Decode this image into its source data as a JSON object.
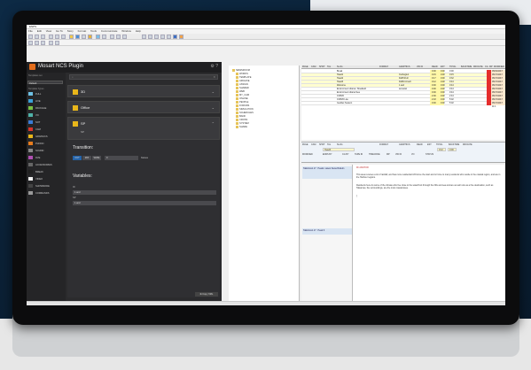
{
  "window": {
    "title": "ENPS"
  },
  "menu": [
    "File",
    "Edit",
    "View",
    "Go To",
    "Story",
    "Format",
    "Tools",
    "Communicate",
    "Window",
    "Help"
  ],
  "plugin": {
    "title": "Mosart NCS Plugin",
    "templates_label": "Templates set",
    "templates_value": "Default",
    "types_label": "Template Types",
    "side_items": [
      {
        "label": "FULL",
        "color": "#6ec1e4"
      },
      {
        "label": "LIVE",
        "color": "#3aa0d8"
      },
      {
        "label": "PACKAGE",
        "color": "#7ac143"
      },
      {
        "label": "VO",
        "color": "#4fb3a9"
      },
      {
        "label": "SOT",
        "color": "#3a7bd5"
      },
      {
        "label": "CAM",
        "color": "#d9342b"
      },
      {
        "label": "GRAPHICS",
        "color": "#e8b61a"
      },
      {
        "label": "PHONO",
        "color": "#e77c1d"
      },
      {
        "label": "SOUND",
        "color": "#888888"
      },
      {
        "label": "DVE",
        "color": "#b04fb2"
      },
      {
        "label": "ACCESSORIES",
        "color": "#666666"
      },
      {
        "label": "BREAK",
        "color": "#202020"
      },
      {
        "label": "VIDEO",
        "color": "#f0f0f0"
      },
      {
        "label": "SHOWMODE",
        "color": "#444444"
      },
      {
        "label": "COMMANDS",
        "color": "#999999"
      }
    ],
    "sections": [
      {
        "label": "3D"
      },
      {
        "label": "Office"
      },
      {
        "label": "SP"
      }
    ],
    "sp_sub": "SP",
    "transition_label": "Transition:",
    "transition_buttons": [
      "CUT",
      "MIX",
      "WIPE"
    ],
    "transition_value": "0",
    "transition_unit": "frames",
    "variables_label": "Variables:",
    "var1_label": "ID",
    "var1_value": "1 and",
    "var2_label": "SP",
    "var2_value": "1 and",
    "copy_button": "Copy XML"
  },
  "tree": [
    "NEWSROOM",
    "WORKS",
    "TEMPLATE",
    "ARCHIVE",
    "ASSIGN",
    "SHARED",
    "WEB",
    "MY_CAM",
    "ONLINE",
    "PEOPLE",
    "FORUMS",
    "SIMULATION",
    "SCHEDULES",
    "BANK",
    "CROSS",
    "SYSTEM",
    "SHARE"
  ],
  "grid": {
    "headers": [
      "PAGE",
      "CAM",
      "SHOT",
      "TAL",
      "SLUG",
      "FORMAT",
      "GRAPHICS",
      "VID ID",
      "READ",
      "EST",
      "TOTAL",
      "BACKTIME",
      "MR DATE",
      "CG",
      "MP",
      "MODIFIED"
    ],
    "rows": [
      {
        "slug": "Break",
        "grx": "",
        "read": "0:00",
        "est": "0:00",
        "tot": "0:00",
        "mod": "05/04/2017 15:0"
      },
      {
        "slug": "Head1",
        "grx": "CutAngle1",
        "read": "0:15",
        "est": "0:00",
        "tot": "0:15",
        "mod": "05/17/2017 11:1"
      },
      {
        "slug": "Head2",
        "grx": "DollToFull",
        "read": "0:17",
        "est": "0:00",
        "tot": "0:32",
        "mod": "05/17/2017 11:1"
      },
      {
        "slug": "Head3",
        "grx": "DollFromLeft",
        "read": "0:12",
        "est": "0:00",
        "tot": "0:44",
        "mod": "05/17/2017 11:1"
      },
      {
        "slug": "Welcome",
        "grx": "1 and",
        "read": "0:00",
        "est": "0:00",
        "tot": "0:44",
        "mod": "05/17/2017 11:1"
      },
      {
        "slug": "Environment drama / Sheafield",
        "grx": "ancestal",
        "read": "0:00",
        "est": "0:00",
        "tot": "0:44",
        "mod": "05/17/2017 11:1"
      },
      {
        "slug": "Environment drama Sea",
        "grx": "",
        "read": "0:00",
        "est": "0:00",
        "tot": "0:44",
        "mod": "05/17/2017 11:1"
      },
      {
        "slug": "COP26",
        "grx": "",
        "read": "2:00",
        "est": "0:00",
        "tot": "2:44",
        "mod": "05/17/2017 11:1"
      },
      {
        "slug": "COP26 Live",
        "grx": "",
        "read": "2:18",
        "est": "0:00",
        "tot": "5:02",
        "mod": "05/17/2017 11:1"
      },
      {
        "slug": "Geddes Season",
        "grx": "",
        "read": "0:00",
        "est": "0:00",
        "tot": "5:02",
        "mod": "05/17/2017 11:1"
      }
    ]
  },
  "story": {
    "headers1": [
      "PAGE",
      "CAM",
      "SHOT",
      "TAL",
      "SLUG",
      "FORMAT",
      "GRAPHICS",
      "READ",
      "EST",
      "TOTAL",
      "BACKTIME",
      "MR DATE"
    ],
    "slug": "Head3",
    "read": "0:12",
    "est": "0:00",
    "headers2": [
      "MODIFIED",
      "ENDS BY",
      "CG BY",
      "TAPE ID",
      "TIMECODE",
      "MP",
      "VID ID",
      "VO",
      "STATUS"
    ],
    "tab1": "Talkshow1.17 : Heads: Latest News Bulletin",
    "tab2": "Talkshow1.17 : Head 3",
    "cue": "Mr ANCHOR",
    "para1": "This area receives a lot of rainfall, and has more residential infill since the start and is home to many residents who reside in the coastal region, and are in the Harbour regions.",
    "para2": "Residents here do some of the climate who live close to the waterfront through the hills and sea and are as well now as a fine destination, such as Talsarnau, the surroundings, are the most coastal area.",
    "para3": "]"
  }
}
